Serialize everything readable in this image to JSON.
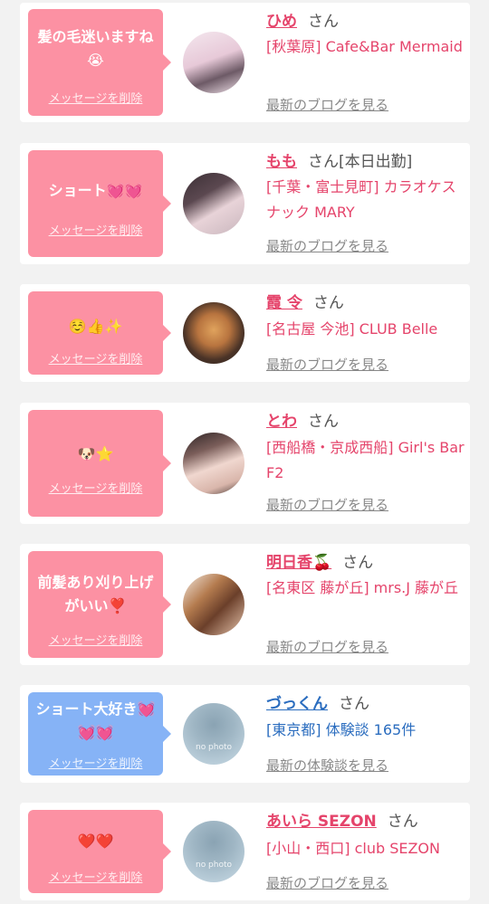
{
  "cards": [
    {
      "message": "髪の毛迷いますね😭",
      "delete_label": "メッセージを削除",
      "name": "ひめ",
      "honorific": "さん",
      "shop": "[秋葉原] Cafe&Bar Mermaid",
      "blog_link": "最新のブログを見る"
    },
    {
      "message": "ショート💓💓",
      "delete_label": "メッセージを削除",
      "name": "もも",
      "honorific": "さん[本日出勤]",
      "shop": "[千葉・富士見町] カラオケスナック MARY",
      "blog_link": "最新のブログを見る"
    },
    {
      "message": "☺️👍✨",
      "delete_label": "メッセージを削除",
      "name": "霞 令",
      "honorific": "さん",
      "shop": "[名古屋 今池] CLUB Belle",
      "blog_link": "最新のブログを見る"
    },
    {
      "message": "🐶⭐",
      "delete_label": "メッセージを削除",
      "name": "とわ",
      "honorific": "さん",
      "shop": "[西船橋・京成西船] Girl's Bar F2",
      "blog_link": "最新のブログを見る"
    },
    {
      "message": "前髪あり刈り上げがいい❣️",
      "delete_label": "メッセージを削除",
      "name": "明日香🍒",
      "honorific": "さん",
      "shop": "[名東区 藤が丘] mrs.J 藤が丘",
      "blog_link": "最新のブログを見る"
    },
    {
      "message": "ショート大好き💓💓💓",
      "delete_label": "メッセージを削除",
      "name": "づっくん",
      "honorific": "さん",
      "shop": "[東京都] 体験談 165件",
      "blog_link": "最新の体験談を見る",
      "avatar_text": "no photo"
    },
    {
      "message": "❤️❤️",
      "delete_label": "メッセージを削除",
      "name": "あいら SEZON",
      "honorific": "さん",
      "shop": "[小山・西口] club SEZON",
      "blog_link": "最新のブログを見る",
      "avatar_text": "no photo"
    }
  ],
  "colors": {
    "bubble_pink": "#fc91a3",
    "bubble_blue": "#86b3f6",
    "name_pink": "#e5446b",
    "name_blue": "#2b6dbf",
    "link_gray": "#888888",
    "background": "#f2f2f2"
  }
}
